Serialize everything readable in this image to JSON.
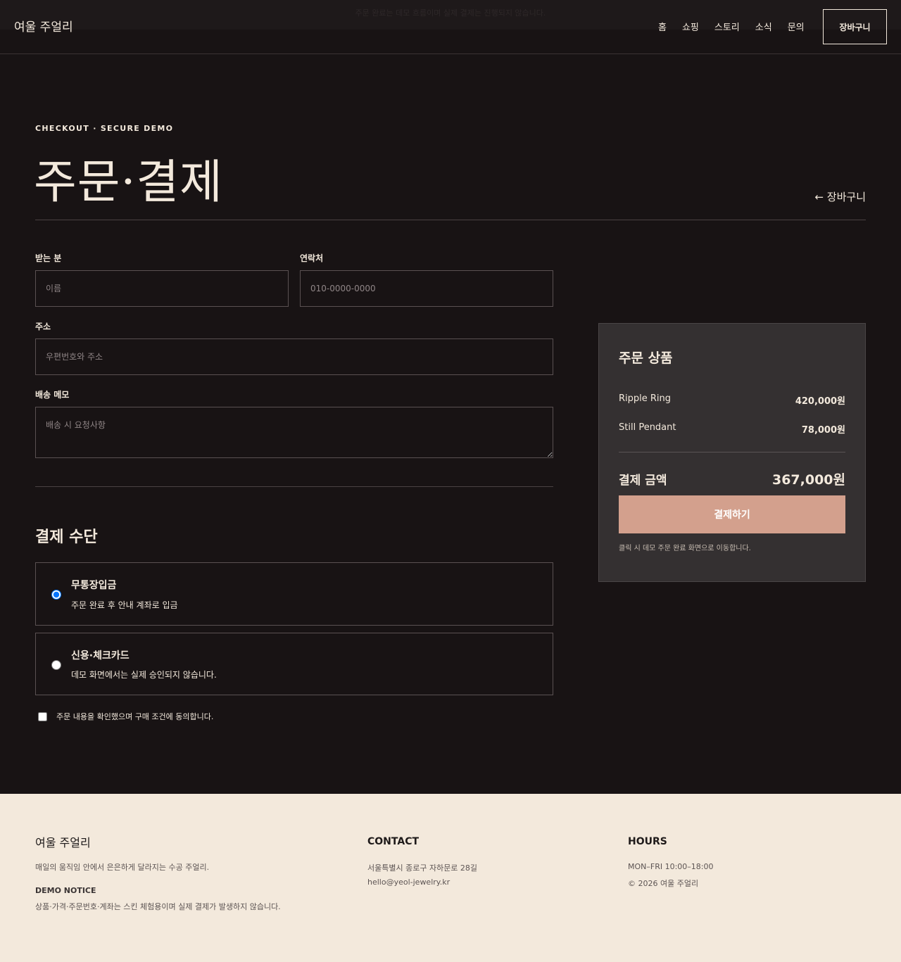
{
  "header": {
    "notice": "주문 완료는 데모 흐름이며 실제 결제는 진행되지 않습니다.",
    "brand": "여울 주얼리",
    "nav": [
      "홈",
      "쇼핑",
      "스토리",
      "소식",
      "문의"
    ],
    "cart": "장바구니"
  },
  "page": {
    "eyebrow": "CHECKOUT · SECURE DEMO",
    "title": "주문·결제",
    "back_link": "← 장바구니"
  },
  "form": {
    "recipient_label": "받는 분",
    "recipient_placeholder": "이름",
    "phone_label": "연락처",
    "phone_placeholder": "010-0000-0000",
    "address_label": "주소",
    "address_placeholder": "우편번호와 주소",
    "memo_label": "배송 메모",
    "memo_placeholder": "배송 시 요청사항"
  },
  "payment": {
    "title": "결제 수단",
    "options": [
      {
        "title": "무통장입금",
        "desc": "주문 완료 후 안내 계좌로 입금",
        "selected": true
      },
      {
        "title": "신용·체크카드",
        "desc": "데모 화면에서는 실제 승인되지 않습니다.",
        "selected": false
      }
    ],
    "agree": "주문 내용을 확인했으며 구매 조건에 동의합니다."
  },
  "summary": {
    "title": "주문 상품",
    "items": [
      {
        "name": "Ripple Ring",
        "price": "420,000원"
      },
      {
        "name": "Still Pendant",
        "price": "78,000원"
      }
    ],
    "total_label": "결제 금액",
    "total_value": "367,000원",
    "pay_button": "결제하기",
    "note": "클릭 시 데모 주문 완료 화면으로 이동합니다."
  },
  "footer": {
    "brand": "여울 주얼리",
    "desc": "매일의 움직임 안에서 은은하게 달라지는 수공 주얼리.",
    "notice_title": "DEMO NOTICE",
    "notice": "상품·가격·주문번호·계좌는 스킨 체험용이며 실제 결제가 발생하지 않습니다.",
    "contact_title": "CONTACT",
    "address": "서울특별시 종로구 자하문로 28길",
    "email": "hello@yeol-jewelry.kr",
    "hours_title": "HOURS",
    "hours": "MON–FRI 10:00–18:00",
    "copyright": "© 2026 여울 주얼리"
  },
  "colors": {
    "background": "#181314",
    "text": "#f3e9dc",
    "accent": "#d3a08d",
    "summary_bg": "#343031",
    "footer_bg": "#f3e9dc"
  }
}
